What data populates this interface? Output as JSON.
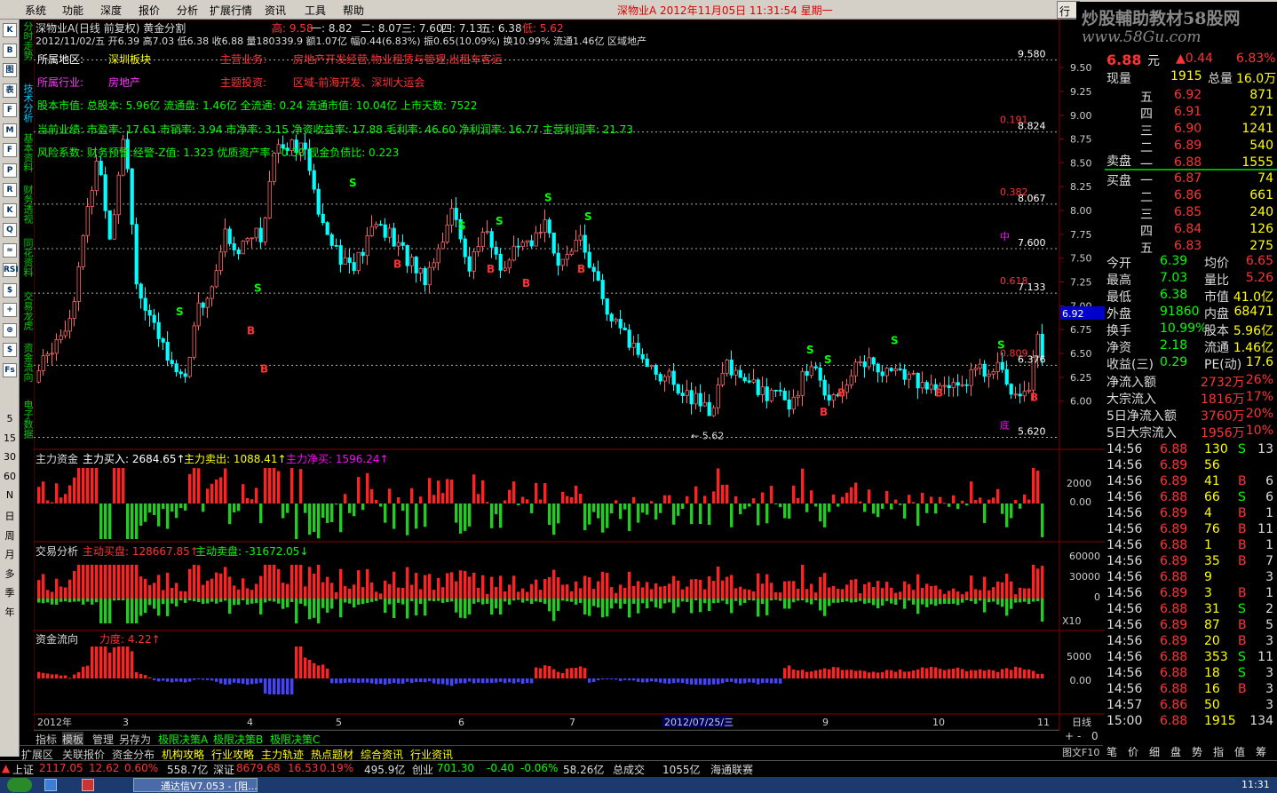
{
  "menu": {
    "items": [
      "系统",
      "功能",
      "深度",
      "报价",
      "分析",
      "扩展行情",
      "资讯",
      "工具",
      "帮助"
    ],
    "stock_title": "深物业A 2012年11月05日 11:31:54 星期一",
    "trade_btn": "行情"
  },
  "watermark": {
    "line1": "炒股輔助教材58股网",
    "line2": "www.58Gu.com"
  },
  "side_tabs": [
    "分时走势",
    "技术分析",
    "基本资料",
    "财务透视",
    "同花资料",
    "交易龙虎",
    "资金流向",
    "电子数据"
  ],
  "periods": [
    "5",
    "15",
    "30",
    "60",
    "N",
    "日",
    "周",
    "月",
    "多",
    "季",
    "年"
  ],
  "left_icons": [
    "K",
    "B",
    "图",
    "表",
    "F",
    "M",
    "F",
    "P",
    "R",
    "K",
    "Q",
    "≈",
    "RSI",
    "$",
    "+",
    "⊕",
    "$",
    "Fs"
  ],
  "chart": {
    "header": "深物业A(日线 前复权) 黄金分割",
    "ohlc_top": {
      "high_label": "高: 9.58",
      "l1": "一: 8.82",
      "l2": "二: 8.07",
      "l3": "三: 7.60",
      "l4": "四: 7.13",
      "l5": "五: 6.38",
      "low_label": "低: 5.62"
    },
    "day_info": "2012/11/02/五 开6.39 高7.03 低6.38 收6.88 量180339.9 额1.07亿 幅0.44(6.83%) 振0.65(10.09%) 换10.99% 流通1.46亿 区域地产",
    "f10": [
      {
        "k": "所属地区:",
        "v": "深圳板块",
        "k2": "主营业务:",
        "v2": "房地产开发经营,物业租赁与管理,出租车客运"
      },
      {
        "k": "所属行业:",
        "v": "房地产",
        "k2": "主题投资:",
        "v2": "区域-前海开发、深圳大运会"
      }
    ],
    "f10_lines": [
      "股本市值: 总股本: 5.96亿 流通盘: 1.46亿 全流通: 0.24 流通市值: 10.04亿 上市天数: 7522",
      "当前业绩: 市盈率: 17.61 市销率: 3.94 市净率: 3.15 净资收益率: 17.88 毛利率: 46.60 净利润率: 16.77 主营利润率: 21.73",
      "风险系数: 财务预警:经警-Z值: 1.323 优质资产率: -0.30 现金负债比: 0.223"
    ],
    "price_ticks": [
      "9.50",
      "9.25",
      "9.00",
      "8.75",
      "8.50",
      "8.25",
      "8.00",
      "7.75",
      "7.50",
      "7.25",
      "7.00",
      "6.75",
      "6.50",
      "6.25",
      "6.00"
    ],
    "gold_levels": [
      {
        "v": "9.580",
        "r": ""
      },
      {
        "v": "8.824",
        "r": "0.191"
      },
      {
        "v": "8.067",
        "r": "0.382"
      },
      {
        "v": "7.600",
        "r": "中"
      },
      {
        "v": "7.133",
        "r": "0.618"
      },
      {
        "v": "6.376",
        "r": "0.809"
      },
      {
        "v": "5.620",
        "r": "底"
      }
    ],
    "current_price": "6.92",
    "low_mark": "5.62",
    "x_labels": [
      "2012年",
      "3",
      "4",
      "5",
      "6",
      "7",
      "2012/07/25/三",
      "9",
      "10",
      "11"
    ],
    "cycle_label": "日线",
    "ind1": {
      "name": "主力资金",
      "t1": "主力买入: 2684.65↑",
      "t2": "主力卖出: 1088.41↑",
      "t3": "主力净买: 1596.24↑",
      "ticks": [
        "2000",
        "0.00"
      ]
    },
    "ind2": {
      "name": "交易分析",
      "t1": "主动买盘: 128667.85↑",
      "t2": "主动卖盘: -31672.05↓",
      "ticks": [
        "60000",
        "30000",
        "0"
      ],
      "mult": "X10"
    },
    "ind3": {
      "name": "资金流向",
      "t1": "力度: 4.22↑",
      "ticks": [
        "5000",
        "0.00"
      ]
    }
  },
  "right": {
    "top": {
      "price": "6.88",
      "unit": "元",
      "chg": "▲0.44",
      "pct": "6.83%"
    },
    "vol": {
      "xl": "现量",
      "xv": "1915",
      "zl": "总量",
      "zv": "16.0万"
    },
    "sells": [
      {
        "l": "五",
        "p": "6.92",
        "v": "871"
      },
      {
        "l": "四",
        "p": "6.91",
        "v": "271"
      },
      {
        "l": "三",
        "p": "6.90",
        "v": "1241"
      },
      {
        "l": "二",
        "p": "6.89",
        "v": "540"
      },
      {
        "l": "一",
        "p": "6.88",
        "v": "1555"
      }
    ],
    "sell_label": "卖盘",
    "buy_label": "买盘",
    "buys": [
      {
        "l": "一",
        "p": "6.87",
        "v": "74"
      },
      {
        "l": "二",
        "p": "6.86",
        "v": "661"
      },
      {
        "l": "三",
        "p": "6.85",
        "v": "240"
      },
      {
        "l": "四",
        "p": "6.84",
        "v": "126"
      },
      {
        "l": "五",
        "p": "6.83",
        "v": "275"
      }
    ],
    "stats": [
      {
        "a": "今开",
        "b": "6.39",
        "c": "均价",
        "d": "6.65"
      },
      {
        "a": "最高",
        "b": "7.03",
        "c": "量比",
        "d": "5.26"
      },
      {
        "a": "最低",
        "b": "6.38",
        "c": "市值",
        "d": "41.0亿"
      },
      {
        "a": "外盘",
        "b": "91860",
        "c": "内盘",
        "d": "68471"
      },
      {
        "a": "换手",
        "b": "10.99%",
        "c": "股本",
        "d": "5.96亿"
      },
      {
        "a": "净资",
        "b": "2.18",
        "c": "流通",
        "d": "1.46亿"
      },
      {
        "a": "收益(三)",
        "b": "0.29",
        "c": "PE(动)",
        "d": "17.6"
      }
    ],
    "flows": [
      {
        "a": "净流入额",
        "b": "2732万",
        "c": "26%"
      },
      {
        "a": "大宗流入",
        "b": "1816万",
        "c": "17%"
      },
      {
        "a": "5日净流入额",
        "b": "3760万",
        "c": "20%"
      },
      {
        "a": "5日大宗流入",
        "b": "1956万",
        "c": "10%"
      }
    ],
    "ticks": [
      [
        "14:56",
        "6.88",
        "130",
        "S",
        "13"
      ],
      [
        "14:56",
        "6.89",
        "56",
        "",
        ""
      ],
      [
        "14:56",
        "6.89",
        "41",
        "B",
        "6"
      ],
      [
        "14:56",
        "6.88",
        "66",
        "S",
        "6"
      ],
      [
        "14:56",
        "6.89",
        "4",
        "B",
        "1"
      ],
      [
        "14:56",
        "6.89",
        "76",
        "B",
        "11"
      ],
      [
        "14:56",
        "6.88",
        "1",
        "B",
        "1"
      ],
      [
        "14:56",
        "6.89",
        "35",
        "B",
        "7"
      ],
      [
        "14:56",
        "6.88",
        "9",
        "",
        "3"
      ],
      [
        "14:56",
        "6.89",
        "3",
        "B",
        "1"
      ],
      [
        "14:56",
        "6.88",
        "31",
        "S",
        "2"
      ],
      [
        "14:56",
        "6.89",
        "87",
        "B",
        "5"
      ],
      [
        "14:56",
        "6.89",
        "20",
        "B",
        "3"
      ],
      [
        "14:56",
        "6.88",
        "353",
        "S",
        "11"
      ],
      [
        "14:56",
        "6.88",
        "18",
        "S",
        "3"
      ],
      [
        "14:56",
        "6.88",
        "16",
        "B",
        "3"
      ],
      [
        "14:57",
        "6.86",
        "50",
        "",
        "3"
      ],
      [
        "15:00",
        "6.88",
        "1915",
        "",
        "134"
      ]
    ],
    "bottom_tabs": [
      "笔",
      "价",
      "细",
      "盘",
      "势",
      "指",
      "值",
      "筹"
    ],
    "f10_btn": "图文F10"
  },
  "tabs1": [
    "指标",
    "模板",
    "管理",
    "另存为",
    "极限决策A",
    "极限决策B",
    "极限决策C"
  ],
  "tabs2": [
    "扩展区",
    "关联报价",
    "资金分布",
    "机构攻略",
    "行业攻略",
    "主力轨迹",
    "热点题材",
    "综合资讯",
    "行业资讯"
  ],
  "zoom": {
    "plus": "+",
    "minus": "-",
    "zero": "0"
  },
  "status": {
    "sh_name": "上证",
    "sh_idx": "2117.05",
    "sh_chg": "12.62",
    "sh_pct": "0.60%",
    "sh_amt": "558.7亿",
    "sz_name": "深证",
    "sz_idx": "8679.68",
    "sz_chg": "16.53",
    "sz_pct": "0.19%",
    "sz_amt": "495.9亿",
    "cy_name": "创业",
    "cy_idx": "701.30",
    "cy_chg": "-0.40",
    "cy_pct": "-0.06%",
    "cy_amt": "58.26亿",
    "total_label": "总成交",
    "total": "1055亿",
    "broker": "海通联赛"
  },
  "taskbar": {
    "app": "通达信V7.053 - [阻...",
    "clock": "11:31"
  }
}
